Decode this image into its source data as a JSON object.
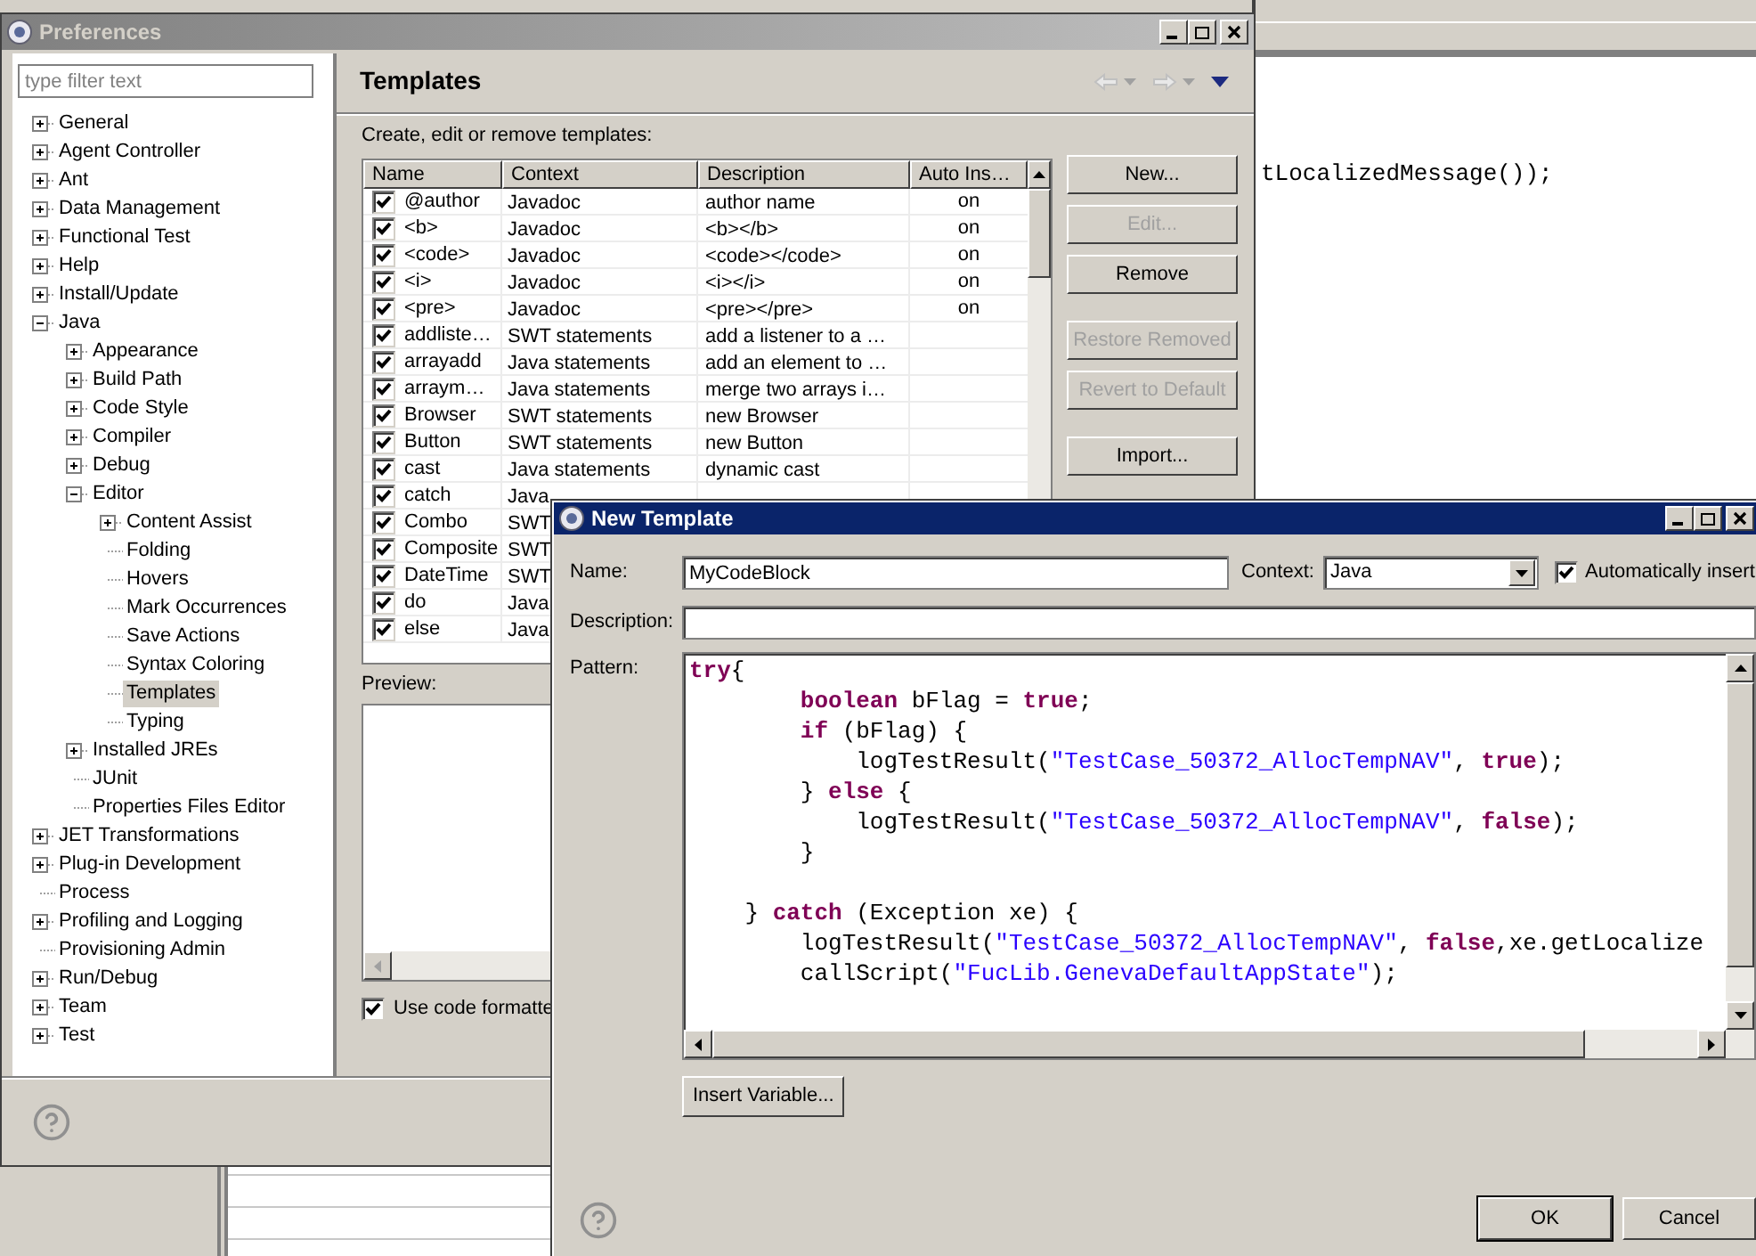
{
  "background_editor": {
    "code_line": "tLocalizedMessage());"
  },
  "preferences": {
    "title": "Preferences",
    "filter": {
      "placeholder": "type filter text"
    },
    "tree": [
      {
        "label": "General",
        "kind": "group",
        "expanded": false,
        "selected": false
      },
      {
        "label": "Agent Controller",
        "kind": "group",
        "expanded": false,
        "selected": false
      },
      {
        "label": "Ant",
        "kind": "group",
        "expanded": false,
        "selected": false
      },
      {
        "label": "Data Management",
        "kind": "group",
        "expanded": false,
        "selected": false
      },
      {
        "label": "Functional Test",
        "kind": "group",
        "expanded": false,
        "selected": false
      },
      {
        "label": "Help",
        "kind": "group",
        "expanded": false,
        "selected": false
      },
      {
        "label": "Install/Update",
        "kind": "group",
        "expanded": false,
        "selected": false
      },
      {
        "label": "Java",
        "kind": "group",
        "expanded": true,
        "selected": false,
        "children": [
          {
            "label": "Appearance",
            "kind": "group",
            "expanded": false,
            "selected": false
          },
          {
            "label": "Build Path",
            "kind": "group",
            "expanded": false,
            "selected": false
          },
          {
            "label": "Code Style",
            "kind": "group",
            "expanded": false,
            "selected": false
          },
          {
            "label": "Compiler",
            "kind": "group",
            "expanded": false,
            "selected": false
          },
          {
            "label": "Debug",
            "kind": "group",
            "expanded": false,
            "selected": false
          },
          {
            "label": "Editor",
            "kind": "group",
            "expanded": true,
            "selected": false,
            "children": [
              {
                "label": "Content Assist",
                "kind": "group",
                "expanded": false,
                "selected": false
              },
              {
                "label": "Folding",
                "kind": "page",
                "selected": false
              },
              {
                "label": "Hovers",
                "kind": "page",
                "selected": false
              },
              {
                "label": "Mark Occurrences",
                "kind": "page",
                "selected": false
              },
              {
                "label": "Save Actions",
                "kind": "page",
                "selected": false
              },
              {
                "label": "Syntax Coloring",
                "kind": "page",
                "selected": false
              },
              {
                "label": "Templates",
                "kind": "page",
                "selected": true
              },
              {
                "label": "Typing",
                "kind": "page",
                "selected": false
              }
            ]
          },
          {
            "label": "Installed JREs",
            "kind": "group",
            "expanded": false,
            "selected": false
          },
          {
            "label": "JUnit",
            "kind": "page",
            "selected": false
          },
          {
            "label": "Properties Files Editor",
            "kind": "page",
            "selected": false
          }
        ]
      },
      {
        "label": "JET Transformations",
        "kind": "group",
        "expanded": false,
        "selected": false
      },
      {
        "label": "Plug-in Development",
        "kind": "group",
        "expanded": false,
        "selected": false
      },
      {
        "label": "Process",
        "kind": "page",
        "selected": false
      },
      {
        "label": "Profiling and Logging",
        "kind": "group",
        "expanded": false,
        "selected": false
      },
      {
        "label": "Provisioning Admin",
        "kind": "page",
        "selected": false
      },
      {
        "label": "Run/Debug",
        "kind": "group",
        "expanded": false,
        "selected": false
      },
      {
        "label": "Team",
        "kind": "group",
        "expanded": false,
        "selected": false
      },
      {
        "label": "Test",
        "kind": "group",
        "expanded": false,
        "selected": false
      }
    ],
    "page_title": "Templates",
    "description": "Create, edit or remove templates:",
    "table": {
      "columns": [
        "Name",
        "Context",
        "Description",
        "Auto Ins…"
      ],
      "rows": [
        {
          "checked": true,
          "name": "@author",
          "context": "Javadoc",
          "description": "author name",
          "auto_insert": "on"
        },
        {
          "checked": true,
          "name": "<b>",
          "context": "Javadoc",
          "description": "<b></b>",
          "auto_insert": "on"
        },
        {
          "checked": true,
          "name": "<code>",
          "context": "Javadoc",
          "description": "<code></code>",
          "auto_insert": "on"
        },
        {
          "checked": true,
          "name": "<i>",
          "context": "Javadoc",
          "description": "<i></i>",
          "auto_insert": "on"
        },
        {
          "checked": true,
          "name": "<pre>",
          "context": "Javadoc",
          "description": "<pre></pre>",
          "auto_insert": "on"
        },
        {
          "checked": true,
          "name": "addliste…",
          "context": "SWT statements",
          "description": "add a listener to a …"
        },
        {
          "checked": true,
          "name": "arrayadd",
          "context": "Java statements",
          "description": "add an element to …"
        },
        {
          "checked": true,
          "name": "arraym…",
          "context": "Java statements",
          "description": "merge two arrays i…"
        },
        {
          "checked": true,
          "name": "Browser",
          "context": "SWT statements",
          "description": "new Browser"
        },
        {
          "checked": true,
          "name": "Button",
          "context": "SWT statements",
          "description": "new Button"
        },
        {
          "checked": true,
          "name": "cast",
          "context": "Java statements",
          "description": "dynamic cast"
        },
        {
          "checked": true,
          "name": "catch",
          "context": "Java"
        },
        {
          "checked": true,
          "name": "Combo",
          "context": "SWT"
        },
        {
          "checked": true,
          "name": "Composite",
          "context": "SWT"
        },
        {
          "checked": true,
          "name": "DateTime",
          "context": "SWT"
        },
        {
          "checked": true,
          "name": "do",
          "context": "Java"
        },
        {
          "checked": true,
          "name": "else",
          "context": "Java"
        }
      ]
    },
    "buttons": [
      {
        "label": "New...",
        "disabled": false
      },
      {
        "label": "Edit...",
        "disabled": true
      },
      {
        "label": "Remove",
        "disabled": false
      },
      {
        "label": "Restore Removed",
        "disabled": true
      },
      {
        "label": "Revert to Default",
        "disabled": true
      },
      {
        "label": "Import...",
        "disabled": false
      }
    ],
    "preview_label": "Preview:",
    "use_formatter": {
      "label": "Use code formatte",
      "checked": true
    }
  },
  "new_template": {
    "title": "New Template",
    "name_label": "Name:",
    "name_value": "MyCodeBlock",
    "context_label": "Context:",
    "context_value": "Java",
    "auto_insert": {
      "label": "Automatically insert",
      "checked": true
    },
    "description_label": "Description:",
    "pattern_label": "Pattern:",
    "pattern_lines": [
      {
        "kind": "code",
        "tokens": [
          {
            "kind": "keyword",
            "text": "try"
          },
          {
            "kind": "plain",
            "text": "{"
          }
        ]
      },
      {
        "kind": "code",
        "tokens": [
          {
            "kind": "keyword",
            "text": "        boolean"
          },
          {
            "kind": "plain",
            "text": " bFlag = "
          },
          {
            "kind": "keyword",
            "text": "true"
          },
          {
            "kind": "plain",
            "text": ";"
          }
        ]
      },
      {
        "kind": "code",
        "tokens": [
          {
            "kind": "keyword",
            "text": "        if"
          },
          {
            "kind": "plain",
            "text": " (bFlag) {"
          }
        ]
      },
      {
        "kind": "code",
        "tokens": [
          {
            "kind": "plain",
            "text": "            logTestResult("
          },
          {
            "kind": "string",
            "text": "\"TestCase_50372_AllocTempNAV\""
          },
          {
            "kind": "plain",
            "text": ", "
          },
          {
            "kind": "keyword",
            "text": "true"
          },
          {
            "kind": "plain",
            "text": ");"
          }
        ]
      },
      {
        "kind": "code",
        "tokens": [
          {
            "kind": "plain",
            "text": "        } "
          },
          {
            "kind": "keyword",
            "text": "else"
          },
          {
            "kind": "plain",
            "text": " {"
          }
        ]
      },
      {
        "kind": "code",
        "tokens": [
          {
            "kind": "plain",
            "text": "            logTestResult("
          },
          {
            "kind": "string",
            "text": "\"TestCase_50372_AllocTempNAV\""
          },
          {
            "kind": "plain",
            "text": ", "
          },
          {
            "kind": "keyword",
            "text": "false"
          },
          {
            "kind": "plain",
            "text": ");"
          }
        ]
      },
      {
        "kind": "code",
        "tokens": [
          {
            "kind": "plain",
            "text": "        }"
          }
        ]
      },
      {
        "kind": "blank"
      },
      {
        "kind": "code",
        "tokens": [
          {
            "kind": "plain",
            "text": "    } "
          },
          {
            "kind": "keyword",
            "text": "catch"
          },
          {
            "kind": "plain",
            "text": " (Exception xe) {"
          }
        ]
      },
      {
        "kind": "code",
        "tokens": [
          {
            "kind": "plain",
            "text": "        logTestResult("
          },
          {
            "kind": "string",
            "text": "\"TestCase_50372_AllocTempNAV\""
          },
          {
            "kind": "plain",
            "text": ", "
          },
          {
            "kind": "keyword",
            "text": "false"
          },
          {
            "kind": "plain",
            "text": ",xe.getLocalize"
          }
        ]
      },
      {
        "kind": "code",
        "tokens": [
          {
            "kind": "plain",
            "text": "        callScript("
          },
          {
            "kind": "string",
            "text": "\"FucLib.GenevaDefaultAppState\""
          },
          {
            "kind": "plain",
            "text": ");"
          }
        ]
      }
    ],
    "insert_variable": "Insert Variable...",
    "buttons": [
      {
        "label": "OK",
        "default": true
      },
      {
        "label": "Cancel",
        "default": false
      }
    ]
  }
}
